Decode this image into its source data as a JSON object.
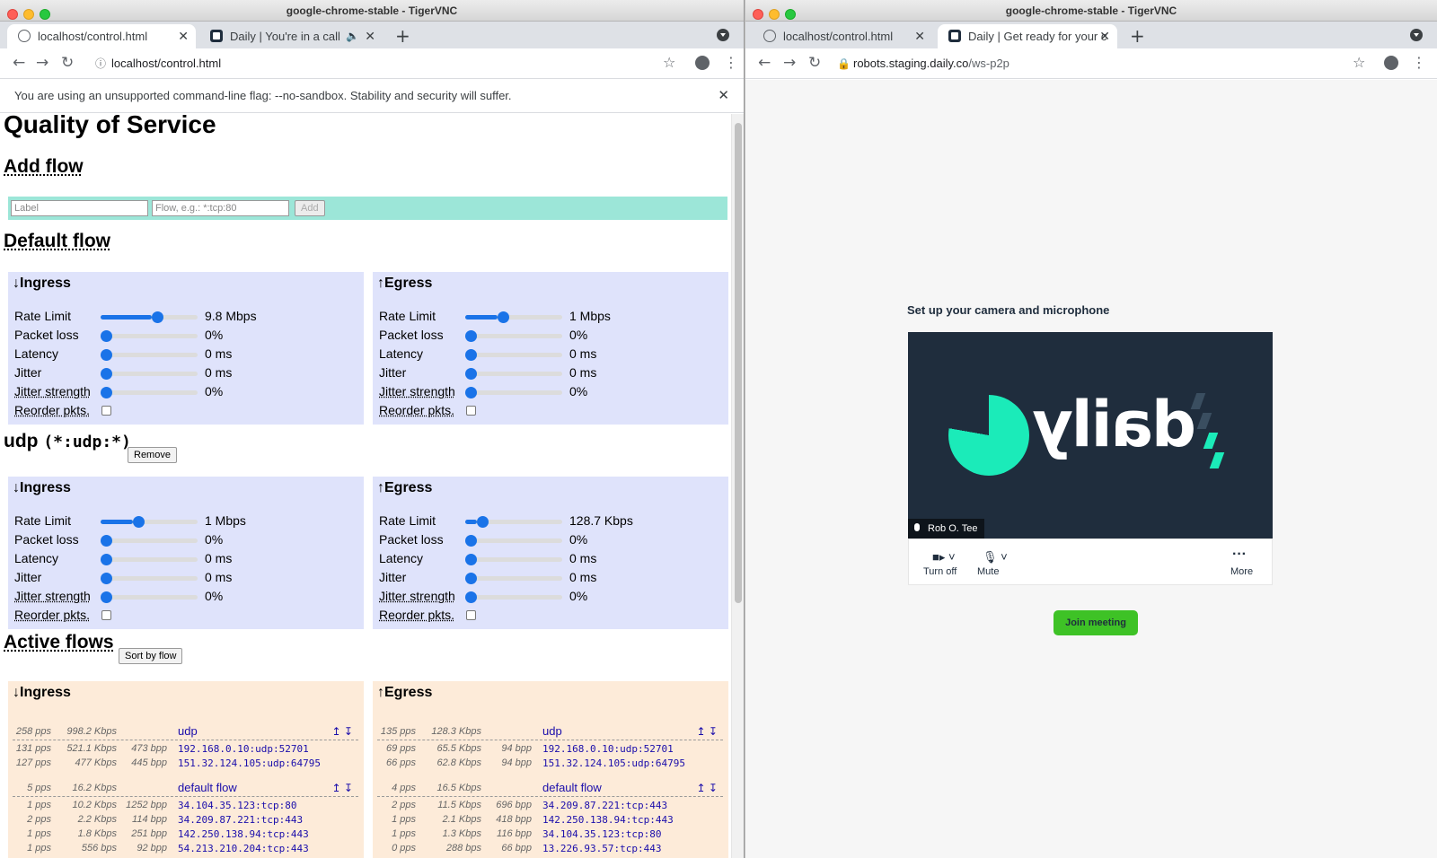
{
  "left": {
    "window_title": "google-chrome-stable - TigerVNC",
    "tabs": [
      {
        "label": "localhost/control.html"
      },
      {
        "label": "Daily | You're in a call"
      }
    ],
    "url": "localhost/control.html",
    "infobar": "You are using an unsupported command-line flag: --no-sandbox. Stability and security will suffer.",
    "page": {
      "title": "Quality of Service",
      "add_flow": {
        "heading": "Add flow",
        "label_placeholder": "Label",
        "flow_placeholder": "Flow, e.g.: *:tcp:80",
        "add_button": "Add"
      },
      "default_flow": {
        "heading": "Default flow",
        "ingress": {
          "title": "↓Ingress",
          "rows": [
            {
              "label": "Rate Limit",
              "value": "9.8 Mbps",
              "level": 0.53
            },
            {
              "label": "Packet loss",
              "value": "0%",
              "level": 0
            },
            {
              "label": "Latency",
              "value": "0 ms",
              "level": 0
            },
            {
              "label": "Jitter",
              "value": "0 ms",
              "level": 0
            },
            {
              "label": "Jitter strength",
              "value": "0%",
              "level": 0
            }
          ],
          "reorder": "Reorder pkts."
        },
        "egress": {
          "title": "↑Egress",
          "rows": [
            {
              "label": "Rate Limit",
              "value": "1 Mbps",
              "level": 0.33
            },
            {
              "label": "Packet loss",
              "value": "0%",
              "level": 0
            },
            {
              "label": "Latency",
              "value": "0 ms",
              "level": 0
            },
            {
              "label": "Jitter",
              "value": "0 ms",
              "level": 0
            },
            {
              "label": "Jitter strength",
              "value": "0%",
              "level": 0
            }
          ],
          "reorder": "Reorder pkts."
        }
      },
      "udp_flow": {
        "heading_name": "udp",
        "heading_spec": "(*:udp:*)",
        "remove_button": "Remove",
        "ingress": {
          "title": "↓Ingress",
          "rows": [
            {
              "label": "Rate Limit",
              "value": "1 Mbps",
              "level": 0.33
            },
            {
              "label": "Packet loss",
              "value": "0%",
              "level": 0
            },
            {
              "label": "Latency",
              "value": "0 ms",
              "level": 0
            },
            {
              "label": "Jitter",
              "value": "0 ms",
              "level": 0
            },
            {
              "label": "Jitter strength",
              "value": "0%",
              "level": 0
            }
          ],
          "reorder": "Reorder pkts."
        },
        "egress": {
          "title": "↑Egress",
          "rows": [
            {
              "label": "Rate Limit",
              "value": "128.7 Kbps",
              "level": 0.12
            },
            {
              "label": "Packet loss",
              "value": "0%",
              "level": 0
            },
            {
              "label": "Latency",
              "value": "0 ms",
              "level": 0
            },
            {
              "label": "Jitter",
              "value": "0 ms",
              "level": 0
            },
            {
              "label": "Jitter strength",
              "value": "0%",
              "level": 0
            }
          ],
          "reorder": "Reorder pkts."
        }
      },
      "active_flows": {
        "heading": "Active flows",
        "sort_button": "Sort by flow",
        "ingress": {
          "title": "↓Ingress",
          "groups": [
            {
              "pps": "258 pps",
              "kbps": "998.2 Kbps",
              "name": "udp",
              "arrows": "↥ ↧",
              "flows": [
                {
                  "pps": "131 pps",
                  "kbps": "521.1 Kbps",
                  "bpp": "473 bpp",
                  "flow": "192.168.0.10:udp:52701"
                },
                {
                  "pps": "127 pps",
                  "kbps": "477 Kbps",
                  "bpp": "445 bpp",
                  "flow": "151.32.124.105:udp:64795"
                }
              ]
            },
            {
              "pps": "5 pps",
              "kbps": "16.2 Kbps",
              "name": "default flow",
              "arrows": "↥ ↧",
              "flows": [
                {
                  "pps": "1 pps",
                  "kbps": "10.2 Kbps",
                  "bpp": "1252 bpp",
                  "flow": "34.104.35.123:tcp:80"
                },
                {
                  "pps": "2 pps",
                  "kbps": "2.2 Kbps",
                  "bpp": "114 bpp",
                  "flow": "34.209.87.221:tcp:443"
                },
                {
                  "pps": "1 pps",
                  "kbps": "1.8 Kbps",
                  "bpp": "251 bpp",
                  "flow": "142.250.138.94:tcp:443"
                },
                {
                  "pps": "1 pps",
                  "kbps": "556 bps",
                  "bpp": "92 bpp",
                  "flow": "54.213.210.204:tcp:443"
                }
              ]
            }
          ]
        },
        "egress": {
          "title": "↑Egress",
          "groups": [
            {
              "pps": "135 pps",
              "kbps": "128.3 Kbps",
              "name": "udp",
              "arrows": "↥ ↧",
              "flows": [
                {
                  "pps": "69 pps",
                  "kbps": "65.5 Kbps",
                  "bpp": "94 bpp",
                  "flow": "192.168.0.10:udp:52701"
                },
                {
                  "pps": "66 pps",
                  "kbps": "62.8 Kbps",
                  "bpp": "94 bpp",
                  "flow": "151.32.124.105:udp:64795"
                }
              ]
            },
            {
              "pps": "4 pps",
              "kbps": "16.5 Kbps",
              "name": "default flow",
              "arrows": "↥ ↧",
              "flows": [
                {
                  "pps": "2 pps",
                  "kbps": "11.5 Kbps",
                  "bpp": "696 bpp",
                  "flow": "34.209.87.221:tcp:443"
                },
                {
                  "pps": "1 pps",
                  "kbps": "2.1 Kbps",
                  "bpp": "418 bpp",
                  "flow": "142.250.138.94:tcp:443"
                },
                {
                  "pps": "1 pps",
                  "kbps": "1.3 Kbps",
                  "bpp": "116 bpp",
                  "flow": "34.104.35.123:tcp:80"
                },
                {
                  "pps": "0 pps",
                  "kbps": "288 bps",
                  "bpp": "66 bpp",
                  "flow": "13.226.93.57:tcp:443"
                }
              ]
            }
          ]
        }
      }
    }
  },
  "right": {
    "window_title": "google-chrome-stable - TigerVNC",
    "tabs": [
      {
        "label": "localhost/control.html"
      },
      {
        "label": "Daily | Get ready for your c"
      }
    ],
    "url_host": "robots.staging.daily.co",
    "url_path": "/ws-p2p",
    "setup_title": "Set up your camera and microphone",
    "logo_text": "daily",
    "participant": "Rob O. Tee",
    "controls": [
      {
        "label": "Turn off",
        "icon": "camera-icon"
      },
      {
        "label": "Mute",
        "icon": "microphone-icon"
      },
      {
        "label": "More",
        "icon": "more-dots-icon"
      }
    ],
    "join_button": "Join meeting",
    "colors": {
      "daily_green": "#1bebb9",
      "daily_dark": "#1f2d3d",
      "join_green": "#3ec226"
    }
  }
}
